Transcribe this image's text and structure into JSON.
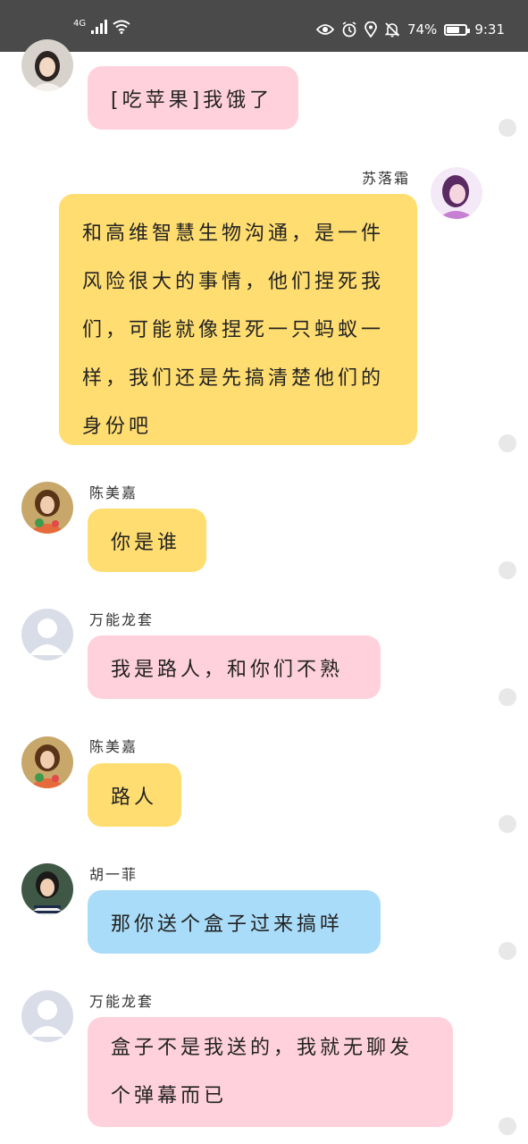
{
  "status_bar": {
    "network": "4G",
    "battery_percent": "74%",
    "battery_level": 0.74,
    "time": "9:31",
    "icons": [
      "signal-icon",
      "wifi-icon",
      "eye-icon",
      "alarm-icon",
      "location-icon",
      "bell-off-icon",
      "battery-icon"
    ]
  },
  "messages": [
    {
      "sender": "",
      "text": "[吃苹果]我饿了",
      "color": "#ffd1dc",
      "side": "left"
    },
    {
      "sender": "苏落霜",
      "text": "和高维智慧生物沟通，是一件风险很大的事情，他们捏死我们，可能就像捏死一只蚂蚁一样，我们还是先搞清楚他们的身份吧",
      "color": "#ffdd70",
      "side": "right"
    },
    {
      "sender": "陈美嘉",
      "text": "你是谁",
      "color": "#ffdd70",
      "side": "left"
    },
    {
      "sender": "万能龙套",
      "text": "我是路人，和你们不熟",
      "color": "#ffd1dc",
      "side": "left"
    },
    {
      "sender": "陈美嘉",
      "text": "路人",
      "color": "#ffdd70",
      "side": "left"
    },
    {
      "sender": "胡一菲",
      "text": "那你送个盒子过来搞咩",
      "color": "#a9dcf8",
      "side": "left"
    },
    {
      "sender": "万能龙套",
      "text": "盒子不是我送的，我就无聊发个弹幕而已",
      "color": "#ffd1dc",
      "side": "left"
    }
  ]
}
